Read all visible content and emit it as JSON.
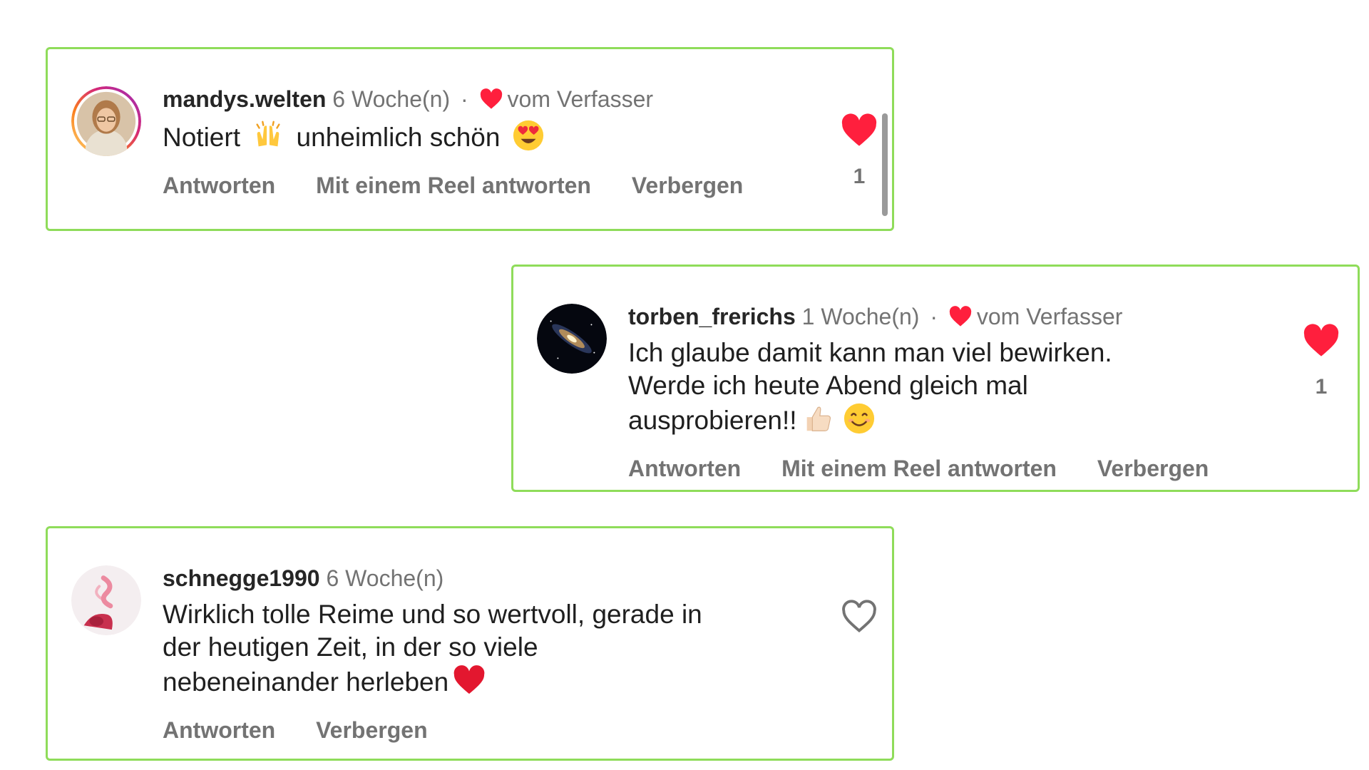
{
  "comments": [
    {
      "username": "mandys.welten",
      "time": "6 Woche(n)",
      "separator": "·",
      "author_liked_label": "vom Verfasser",
      "text_parts": [
        "Notiert",
        "unheimlich schön"
      ],
      "emojis": [
        "raising-hands-emoji",
        "heart-eyes-emoji"
      ],
      "actions": [
        "Antworten",
        "Mit einem Reel antworten",
        "Verbergen"
      ],
      "like_count": "1",
      "liked": true
    },
    {
      "username": "torben_frerichs",
      "time": "1 Woche(n)",
      "separator": "·",
      "author_liked_label": "vom Verfasser",
      "text_lines": [
        "Ich glaube damit kann man viel bewirken.",
        "Werde ich heute Abend gleich mal",
        "ausprobieren!!"
      ],
      "emojis": [
        "thumbs-up-emoji",
        "smiling-face-emoji"
      ],
      "actions": [
        "Antworten",
        "Mit einem Reel antworten",
        "Verbergen"
      ],
      "like_count": "1",
      "liked": true
    },
    {
      "username": "schnegge1990",
      "time": "6 Woche(n)",
      "text_lines": [
        "Wirklich tolle Reime und so wertvoll, gerade in",
        "der heutigen Zeit, in der so viele",
        "nebeneinander herleben"
      ],
      "emojis": [
        "red-heart-emoji"
      ],
      "actions": [
        "Antworten",
        "Verbergen"
      ],
      "liked": false
    }
  ],
  "colors": {
    "border": "#8fdc5a",
    "heart": "#ff1f3d",
    "muted": "#737373",
    "text": "#1f1f1f"
  }
}
